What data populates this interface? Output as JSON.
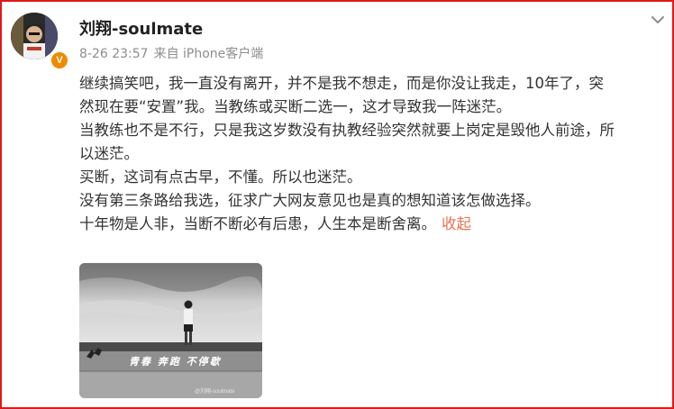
{
  "post": {
    "author": "刘翔-soulmate",
    "timestamp": "8-26 23:57",
    "source": "来自 iPhone客户端",
    "verified_badge": "V",
    "paragraphs": [
      "继续搞笑吧，我一直没有离开，并不是我不想走，而是你没让我走，10年了，突",
      "然现在要“安置”我。当教练或买断二选一，这才导致我一阵迷茫。",
      "当教练也不是不行，只是我这岁数没有执教经验突然就要上岗定是毁他人前途，所",
      "以迷茫。",
      "买断，这词有点古早，不懂。所以也迷茫。",
      "没有第三条路给我选，征求广大网友意见也是真的想知道该怎做选择。",
      "十年物是人非，当断不断必有后患，人生本是断舍离。"
    ],
    "collapse_label": "收起",
    "image": {
      "overlay_text": "青春 奔跑 不停歇",
      "watermark": "@刘翔-soulmate"
    }
  },
  "icons": {
    "more": "chevron-down-icon",
    "badge": "verified-badge-icon"
  },
  "colors": {
    "frame_border": "#e0191c",
    "badge": "#f08a00",
    "link": "#eb7350",
    "meta_text": "#8d8d8d",
    "body_text": "#333333"
  }
}
